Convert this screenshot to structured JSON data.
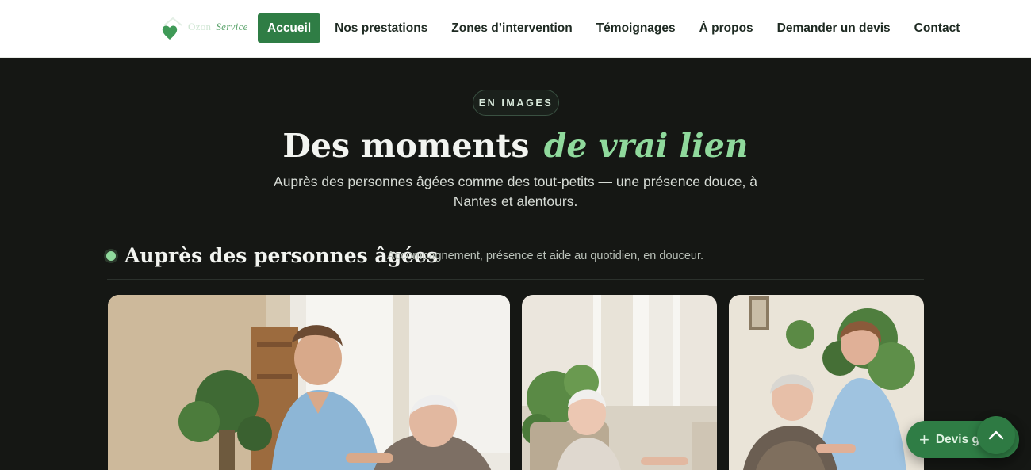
{
  "brand": {
    "name_part1": "Ozon",
    "name_part2": "Service"
  },
  "nav": {
    "items": [
      {
        "label": "Accueil",
        "active": true
      },
      {
        "label": "Nos prestations",
        "active": false
      },
      {
        "label": "Zones d’intervention",
        "active": false
      },
      {
        "label": "Témoignages",
        "active": false
      },
      {
        "label": "À propos",
        "active": false
      },
      {
        "label": "Demander un devis",
        "active": false
      },
      {
        "label": "Contact",
        "active": false
      }
    ]
  },
  "hero": {
    "badge": "EN IMAGES",
    "title_main": "Des moments",
    "title_accent": "de vrai lien",
    "subtitle": "Auprès des personnes âgées comme des tout-petits — une présence douce, à Nantes et alentours."
  },
  "section": {
    "title": "Auprès des personnes âgées",
    "description": "Accompagnement, présence et aide au quotidien, en douceur."
  },
  "gallery": [
    {
      "icon": "photo-caregiver-with-elderly-man"
    },
    {
      "icon": "photo-elderly-woman-at-window"
    },
    {
      "icon": "photo-caregiver-holding-hands-elderly-woman"
    }
  ],
  "floating": {
    "devis_label": "Devis gratuit",
    "plus_icon": "plus-icon",
    "top_icon": "chevron-up-icon"
  },
  "colors": {
    "accent": "#2f7d45",
    "accent_light": "#8fd99c",
    "dark_bg": "#151714"
  }
}
